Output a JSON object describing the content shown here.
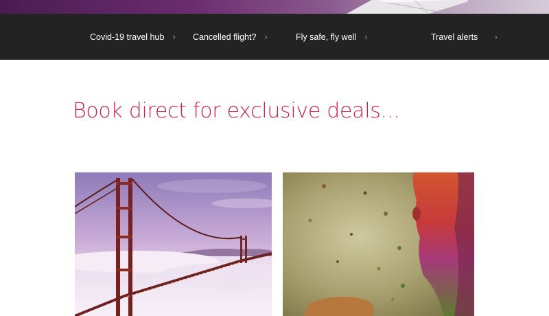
{
  "colors": {
    "nav_bg": "#232323",
    "headline": "#c8214e",
    "hero_purple": "#6a2d6e"
  },
  "hero": {
    "image": "airplane-wing-over-purple-sky"
  },
  "nav": {
    "items": [
      {
        "label": "Covid-19 travel hub",
        "icon": "chevron-right-icon"
      },
      {
        "label": "Cancelled flight?",
        "icon": "chevron-right-icon"
      },
      {
        "label": "Fly safe, fly well",
        "icon": "chevron-right-icon"
      },
      {
        "label": "Travel alerts",
        "icon": "chevron-right-icon"
      }
    ]
  },
  "main": {
    "headline": "Book direct for exclusive deals...",
    "cards": [
      {
        "image": "golden-gate-bridge-in-fog"
      },
      {
        "image": "holi-colour-powder-festival"
      }
    ]
  }
}
